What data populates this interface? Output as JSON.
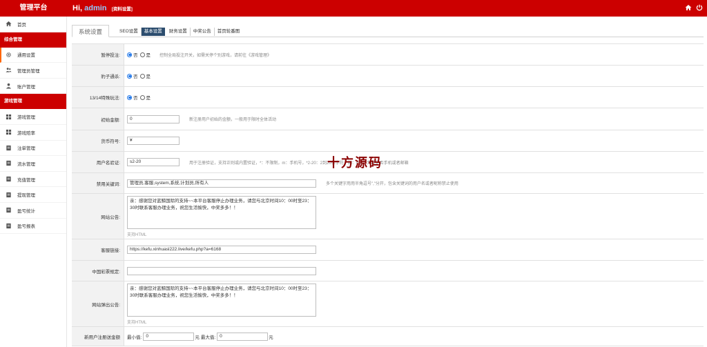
{
  "header": {
    "brand": "管理平台",
    "greeting": "Hi,",
    "username": "admin",
    "profile_link": "[资料设置]",
    "icons": [
      "home-icon",
      "power-icon"
    ]
  },
  "sidebar": {
    "home": "首页",
    "section1": "综合管理",
    "items1": [
      "通用设置",
      "管理员管理",
      "账户管理"
    ],
    "section2": "游戏管理",
    "items2": [
      "游戏管理",
      "游戏赔率",
      "注单管理",
      "流水管理",
      "充值管理",
      "提现管理",
      "盈亏统计",
      "盈亏报表"
    ]
  },
  "tabs": {
    "main": "系统设置",
    "sub": [
      "SEO设置",
      "基本设置",
      "财务设置",
      "中奖公告",
      "首页轮番图"
    ]
  },
  "form": {
    "pause_bet": {
      "label": "暂停投注:",
      "opt_no": "否",
      "opt_yes": "是",
      "hint": "控制全局投注开关，如需关停个别游戏，请前往《游戏管理》"
    },
    "leopard": {
      "label": "豹子通杀:",
      "opt_no": "否",
      "opt_yes": "是"
    },
    "special_1314": {
      "label": "13/14特殊玩法:",
      "opt_no": "否",
      "opt_yes": "是"
    },
    "init_amount": {
      "label": "初始金额:",
      "value": "0",
      "hint": "新注册用户初始的金额，一般用于限时全体活动"
    },
    "currency": {
      "label": "货币符号:",
      "value": "¥"
    },
    "username_rule": {
      "label": "用户名验证:",
      "value": "s2-20",
      "hint": "用于注册验证，支持正则或内置验证，*：不限制，m：手机号，*2-20：2到20位字符，如：m|e：判断是否手机或者邮箱"
    },
    "banned_words": {
      "label": "禁用关键词:",
      "value": "管理员,客服,system,系统,计划员,所有人",
      "hint": "多个关键字用用半角逗号\",\"分开，包含关键词的用户名或者昵称禁止使用"
    },
    "site_notice": {
      "label": "网站公告:",
      "value": "亲：感谢您对蓝鲸国际的支持~~本平台客服停止办理业务，请您与北京时间10：00时至23：30时联系客服办理业务，祝您生活愉快，中奖多多！！",
      "support": "支持HTML"
    },
    "service_link": {
      "label": "客服链接:",
      "value": "https://kefu.xinhuasl222.live/kefu.php?a=6168"
    },
    "lottery_rules": {
      "label": "中国彩票规定:",
      "value": ""
    },
    "popup_notice": {
      "label": "网站弹出公告:",
      "value": "亲：感谢您对蓝鲸国际的支持~~本平台客服停止办理业务，请您与北京时间10：00时至23：30时联系客服办理业务，祝您生活愉快，中奖多多！！",
      "support": "支持HTML"
    },
    "new_user_gift": {
      "label": "新用户注册送金额",
      "min_label": "最小值:",
      "min_value": "0",
      "unit1": "元",
      "max_label": "最大值:",
      "max_value": "0",
      "unit2": "元"
    }
  },
  "watermark": "十方源码"
}
